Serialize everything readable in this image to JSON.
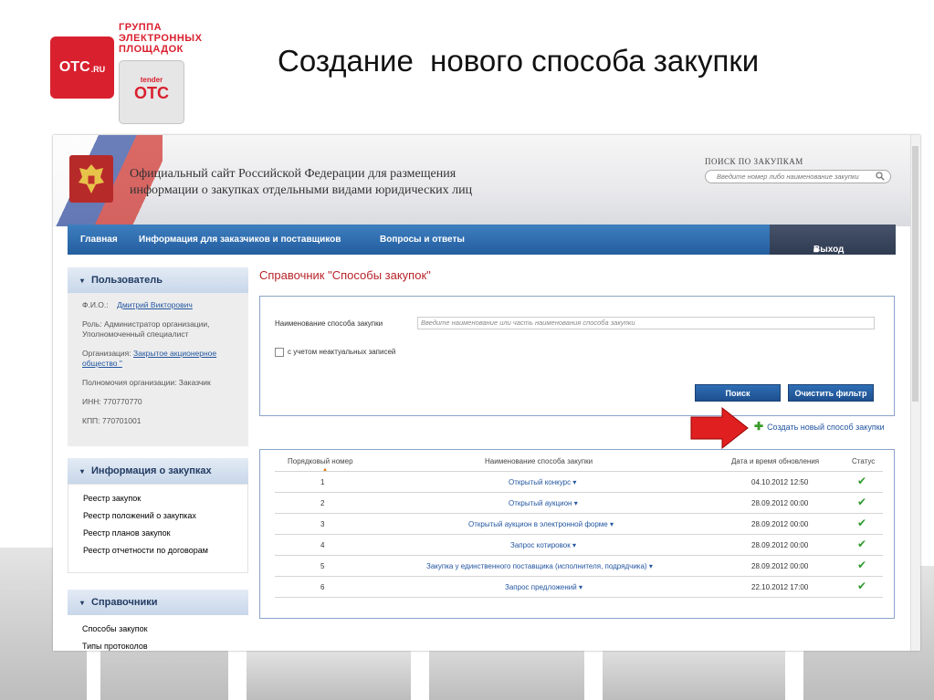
{
  "logo": {
    "brand": "OTC",
    "brand_suffix": ".RU",
    "group_lines": [
      "ГРУППА",
      "ЭЛЕКТРОННЫХ",
      "ПЛОЩАДОК"
    ],
    "tender_small": "tender",
    "tender_big": "OTC"
  },
  "slide_title": "Создание  нового способа закупки",
  "site": {
    "title_line1": "Официальный сайт Российской Федерации для размещения",
    "title_line2": "информации о закупках отдельными видами юридических лиц",
    "search_label": "ПОИСК ПО ЗАКУПКАМ",
    "search_placeholder": "Введите номер либо наименование закупки"
  },
  "nav": {
    "items": [
      "Главная",
      "Информация для заказчиков и поставщиков",
      "Вопросы и ответы"
    ],
    "exit": "Выход"
  },
  "sidebar": {
    "user": {
      "title": "Пользователь",
      "fio_label": "Ф.И.О.:",
      "fio_value": "Дмитрий Викторович",
      "role": "Роль: Администратор организации, Уполномоченный специалист",
      "org_label": "Организация:",
      "org_value": "Закрытое акционерное общество \"",
      "powers": "Полномочия организации: Заказчик",
      "inn": "ИНН: 770770770",
      "kpp": "КПП: 770701001"
    },
    "purchases": {
      "title": "Информация о закупках",
      "links": [
        "Реестр закупок",
        "Реестр положений о закупках",
        "Реестр планов закупок",
        "Реестр отчетности по договорам"
      ]
    },
    "refs": {
      "title": "Справочники",
      "links": [
        "Способы закупок",
        "Типы протоколов"
      ]
    }
  },
  "main": {
    "title": "Справочник \"Способы закупок\"",
    "filter": {
      "name_label": "Наименование способа закупки",
      "name_placeholder": "Введите наименование или часть наименования способа закупки",
      "checkbox_label": "с учетом неактуальных записей",
      "search_button": "Поиск",
      "clear_button": "Очистить фильтр"
    },
    "create_link": "Создать новый способ закупки",
    "table": {
      "headers": [
        "Порядковый номер",
        "Наименование способа закупки",
        "Дата и время обновления",
        "Статус"
      ],
      "rows": [
        {
          "num": "1",
          "name": "Открытый конкурс",
          "date": "04.10.2012 12:50"
        },
        {
          "num": "2",
          "name": "Открытый аукцион",
          "date": "28.09.2012 00:00"
        },
        {
          "num": "3",
          "name": "Открытый аукцион в электронной форме",
          "date": "28.09.2012 00:00"
        },
        {
          "num": "4",
          "name": "Запрос котировок",
          "date": "28.09.2012 00:00"
        },
        {
          "num": "5",
          "name": "Закупка у единственного поставщика (исполнителя, подрядчика)",
          "date": "28.09.2012 00:00"
        },
        {
          "num": "6",
          "name": "Запрос предложений",
          "date": "22.10.2012 17:00"
        }
      ]
    }
  },
  "colors": {
    "brand_red": "#d9202e",
    "nav_blue": "#245e9f",
    "link_blue": "#2356a0",
    "title_red": "#b8242a",
    "status_green": "#2e9a2e"
  }
}
